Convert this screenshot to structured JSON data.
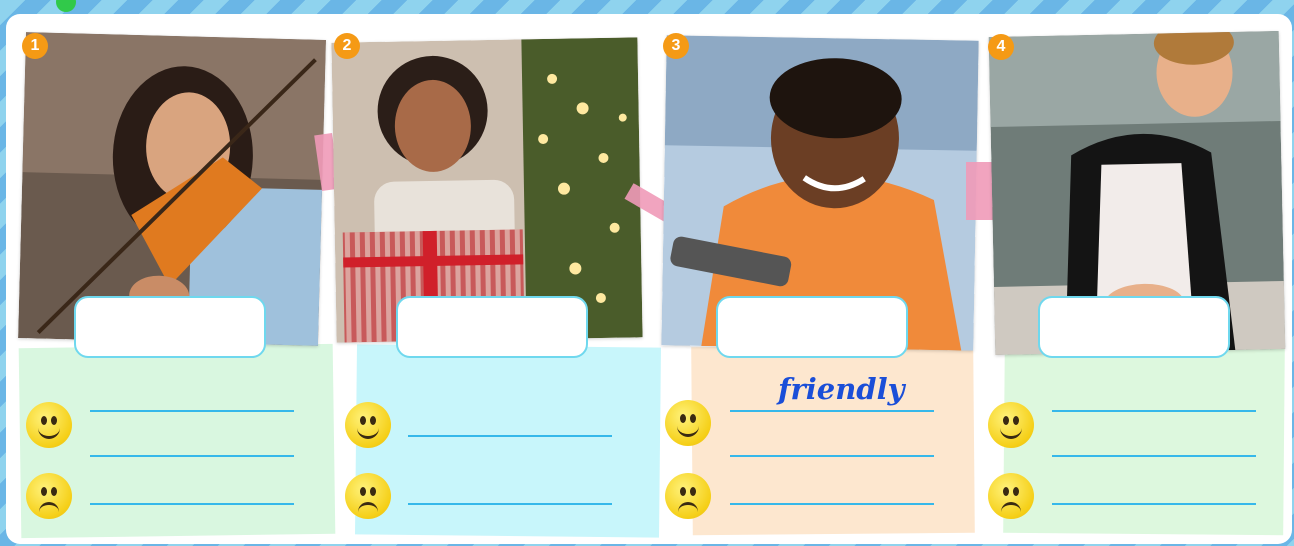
{
  "cards": [
    {
      "number": "1",
      "panel_color": "#d9f7e0",
      "photo_subject": "girl-playing-violin"
    },
    {
      "number": "2",
      "panel_color": "#c8f6fb",
      "photo_subject": "woman-holding-gift"
    },
    {
      "number": "3",
      "panel_color": "#fde7cf",
      "photo_subject": "boy-holding-remote"
    },
    {
      "number": "4",
      "panel_color": "#ddf8de",
      "photo_subject": "boy-cooking-in-apron"
    }
  ],
  "card3_answer": "friendly",
  "icons": {
    "happy": "smiling-face-icon",
    "sad": "frowning-face-icon"
  },
  "colors": {
    "badge": "#f59a15",
    "line": "#36b8ea",
    "box_border": "#6fd8ee",
    "answer_text": "#1a4ed8"
  }
}
